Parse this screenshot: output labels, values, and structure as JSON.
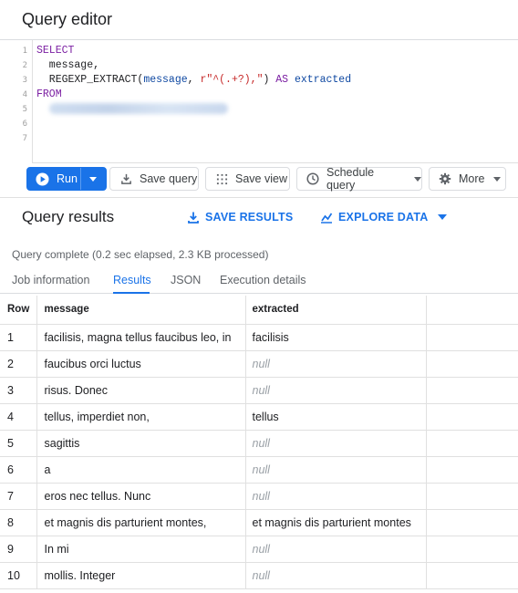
{
  "editor": {
    "title": "Query editor",
    "line_numbers": [
      "1",
      "2",
      "3",
      "4",
      "5",
      "6",
      "7"
    ],
    "code": {
      "l1_kw": "SELECT",
      "l2": "  message,",
      "l3_fn": "  REGEXP_EXTRACT(",
      "l3_id": "message",
      "l3_sep": ", ",
      "l3_str": "r\"^(.+?),\"",
      "l3_close": ") ",
      "l3_as": "AS",
      "l3_alias": " extracted",
      "l4_kw": "FROM"
    }
  },
  "toolbar": {
    "run_label": "Run",
    "save_query_label": "Save query",
    "save_view_label": "Save view",
    "schedule_query_label": "Schedule query",
    "more_label": "More"
  },
  "results": {
    "title": "Query results",
    "save_results_label": "SAVE RESULTS",
    "explore_data_label": "EXPLORE DATA",
    "status": "Query complete (0.2 sec elapsed, 2.3 KB processed)",
    "tabs": [
      "Job information",
      "Results",
      "JSON",
      "Execution details"
    ],
    "active_tab": "Results",
    "columns": [
      "Row",
      "message",
      "extracted"
    ],
    "rows": [
      {
        "row": "1",
        "message": "facilisis, magna tellus faucibus leo, in",
        "extracted": "facilisis"
      },
      {
        "row": "2",
        "message": "faucibus orci luctus",
        "extracted": "null"
      },
      {
        "row": "3",
        "message": "risus. Donec",
        "extracted": "null"
      },
      {
        "row": "4",
        "message": "tellus, imperdiet non,",
        "extracted": "tellus"
      },
      {
        "row": "5",
        "message": "sagittis",
        "extracted": "null"
      },
      {
        "row": "6",
        "message": "a",
        "extracted": "null"
      },
      {
        "row": "7",
        "message": "eros nec tellus. Nunc",
        "extracted": "null"
      },
      {
        "row": "8",
        "message": "et magnis dis parturient montes,",
        "extracted": "et magnis dis parturient montes"
      },
      {
        "row": "9",
        "message": "In mi",
        "extracted": "null"
      },
      {
        "row": "10",
        "message": "mollis. Integer",
        "extracted": "null"
      }
    ]
  },
  "colors": {
    "accent": "#1a73e8",
    "keyword": "#7b1fa2",
    "identifier": "#0d47a1",
    "string": "#c62828",
    "null_text": "#9aa0a6"
  },
  "icons": {
    "run": "play-circle-icon",
    "save_query": "save-icon",
    "save_view": "grid-icon",
    "schedule_query": "clock-icon",
    "more": "gear-icon",
    "save_results": "download-icon",
    "explore_data": "bar-chart-icon"
  }
}
